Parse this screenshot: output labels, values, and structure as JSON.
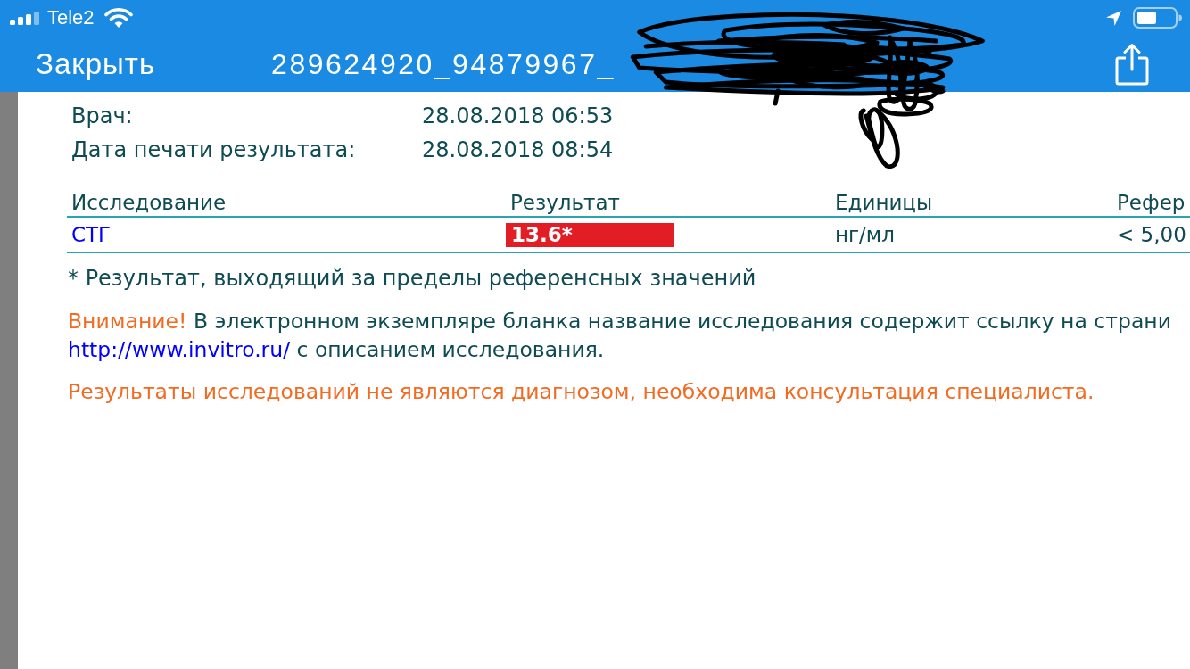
{
  "status_bar": {
    "carrier": "Tele2"
  },
  "nav_bar": {
    "close_button": "Закрыть",
    "title": "289624920_94879967_"
  },
  "document": {
    "info_rows": [
      {
        "label": "Врач:",
        "value": "28.08.2018 06:53"
      },
      {
        "label": "Дата печати результата:",
        "value": "28.08.2018 08:54"
      }
    ],
    "table": {
      "columns": [
        "Исследование",
        "Результат",
        "Единицы",
        "Рефер"
      ],
      "rows": [
        {
          "test": "СТГ",
          "result": "13.6*",
          "out_of_range": true,
          "units": "нг/мл",
          "reference": "< 5,00"
        }
      ]
    },
    "footnote": "* Результат, выходящий за пределы референсных значений",
    "notice": {
      "label": "Внимание!",
      "text": "В электронном экземпляре бланка название исследования содержит ссылку на страни",
      "link": "http://www.invitro.ru/",
      "link_suffix": "с описанием исследования."
    },
    "disclaimer": "Результаты исследований не являются диагнозом, необходима консультация специалиста."
  }
}
